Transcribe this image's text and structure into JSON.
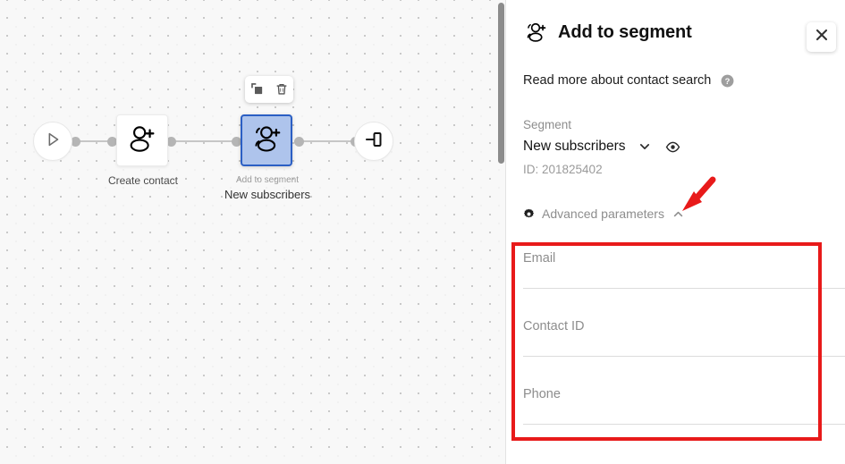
{
  "canvas": {
    "nodes": [
      {
        "id": "start",
        "type": "start",
        "icon": "play-icon",
        "label": ""
      },
      {
        "id": "create-contact",
        "type": "action",
        "icon": "add-person-icon",
        "label": "Create contact"
      },
      {
        "id": "add-to-segment",
        "type": "action-selected",
        "icon": "add-to-segment-icon",
        "sublabel": "Add to segment",
        "label": "New subscribers"
      },
      {
        "id": "end",
        "type": "end",
        "icon": "end-icon",
        "label": ""
      }
    ],
    "node_toolbar": {
      "duplicate_icon": "duplicate-icon",
      "delete_icon": "trash-icon"
    },
    "scrollbar": {
      "visible": true
    }
  },
  "panel": {
    "title": "Add to segment",
    "title_icon": "add-to-segment-icon",
    "close_label": "×",
    "close_icon": "close-icon",
    "readmore": {
      "text": "Read more about contact search",
      "help_icon": "help-circle-icon"
    },
    "segment": {
      "label": "Segment",
      "value": "New subscribers",
      "chevron_icon": "chevron-down-icon",
      "preview_icon": "eye-icon",
      "id_text": "ID: 201825402"
    },
    "advanced": {
      "gear_icon": "gear-icon",
      "label": "Advanced parameters",
      "chevron_icon": "chevron-up-icon",
      "expanded": true
    },
    "fields": [
      {
        "name": "email",
        "placeholder": "Email",
        "value": ""
      },
      {
        "name": "contact-id",
        "placeholder": "Contact ID",
        "value": ""
      },
      {
        "name": "phone",
        "placeholder": "Phone",
        "value": ""
      }
    ]
  },
  "annotations": {
    "highlight_color": "#e81a1a",
    "arrow_color": "#e81a1a",
    "highlight_target": "advanced-parameters-fields",
    "arrow_target": "advanced-parameters-toggle"
  }
}
